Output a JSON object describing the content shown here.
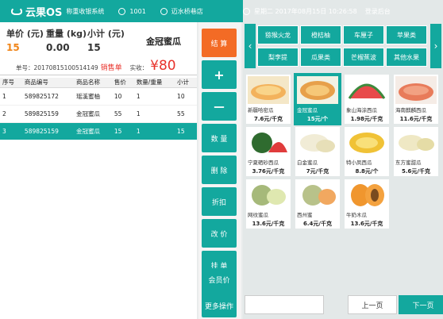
{
  "topbar": {
    "brand": "云果OS",
    "subtitle": "称重收银系统",
    "user_id": "1001",
    "store": "迈水桥巷店",
    "datetime": "星期二 2017年08月15日 10:26:58",
    "logout": "登录后台"
  },
  "summary": {
    "unit_price_label": "单价 (元)",
    "unit_price": "15",
    "weight_label": "重量 (kg)",
    "weight": "0.00",
    "subtotal_label": "小计 (元)",
    "subtotal": "15",
    "product_name": "金冠蜜瓜"
  },
  "order": {
    "number_label": "单号：",
    "number": "20170815100514149",
    "status": "销售单",
    "paid_label": "实收：",
    "paid": "¥80"
  },
  "table": {
    "headers": [
      "序号",
      "商品编号",
      "商品名称",
      "售价",
      "数量/重量",
      "小计"
    ],
    "rows": [
      [
        "1",
        "589825172",
        "瑶溪蜜柚",
        "10",
        "1",
        "10"
      ],
      [
        "2",
        "589825159",
        "金冠蜜瓜",
        "55",
        "1",
        "55"
      ],
      [
        "3",
        "589825159",
        "金冠蜜瓜",
        "15",
        "1",
        "15"
      ]
    ]
  },
  "buttons": {
    "settle": "结 算",
    "plus": "+",
    "minus": "－",
    "quantity": "数 量",
    "delete": "删 除",
    "discount": "折扣",
    "change_price": "改 价",
    "hold": "挂 单",
    "loss": "报 损",
    "member_price": "会员价",
    "more": "更多操作"
  },
  "categories": [
    "猕猴火龙",
    "橙桔柚",
    "车厘子",
    "苹果类",
    "梨李提",
    "瓜果类",
    "芒榴蕉波",
    "其他水果"
  ],
  "products": [
    {
      "name": "新疆哈密瓜",
      "price": "7.6元/千克"
    },
    {
      "name": "金冠蜜瓜",
      "price": "15元/个"
    },
    {
      "name": "象山海涂西瓜",
      "price": "1.98元/千克"
    },
    {
      "name": "海南麒麟西瓜",
      "price": "11.6元/千克"
    },
    {
      "name": "宁夏硒砂西瓜",
      "price": "3.76元/千克"
    },
    {
      "name": "白金蜜瓜",
      "price": "7元/千克"
    },
    {
      "name": "特小凤西瓜",
      "price": "8.8元/个"
    },
    {
      "name": "东方蜜甜瓜",
      "price": "5.6元/千克"
    },
    {
      "name": "网纹蜜瓜",
      "price": "13.6元/千克"
    },
    {
      "name": "西州蜜",
      "price": "6.4元/千克"
    },
    {
      "name": "牛奶木瓜",
      "price": "13.6元/千克"
    }
  ],
  "pager": {
    "prev": "上一页",
    "next": "下一页"
  },
  "colors": {
    "primary": "#13a89e",
    "accent": "#f36b25",
    "price": "#e8312a"
  }
}
